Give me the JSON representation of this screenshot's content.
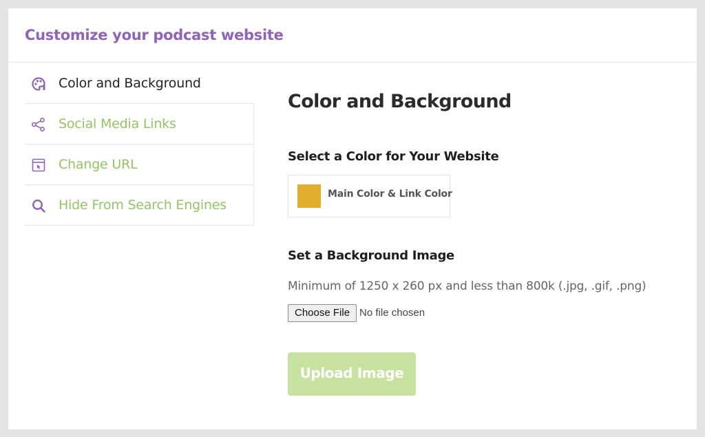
{
  "header": {
    "title": "Customize your podcast website"
  },
  "sidebar": {
    "items": [
      {
        "label": "Color and Background",
        "icon": "palette-icon",
        "active": true
      },
      {
        "label": "Social Media Links",
        "icon": "share-icon",
        "active": false
      },
      {
        "label": "Change URL",
        "icon": "browser-window-icon",
        "active": false
      },
      {
        "label": "Hide From Search Engines",
        "icon": "search-icon",
        "active": false
      }
    ]
  },
  "main": {
    "section_title": "Color and Background",
    "color_section": {
      "heading": "Select a Color for Your Website",
      "color_label": "Main Color & Link Color",
      "swatch_color": "#e2ae2e"
    },
    "background_section": {
      "heading": "Set a Background Image",
      "hint": "Minimum of 1250 x 260 px and less than 800k (.jpg, .gif, .png)",
      "choose_file_label": "Choose File",
      "file_status": "No file chosen",
      "upload_label": "Upload Image"
    }
  },
  "colors": {
    "brand_purple": "#8e63b8",
    "accent_green": "#93c564",
    "upload_disabled": "#c7e29f"
  }
}
